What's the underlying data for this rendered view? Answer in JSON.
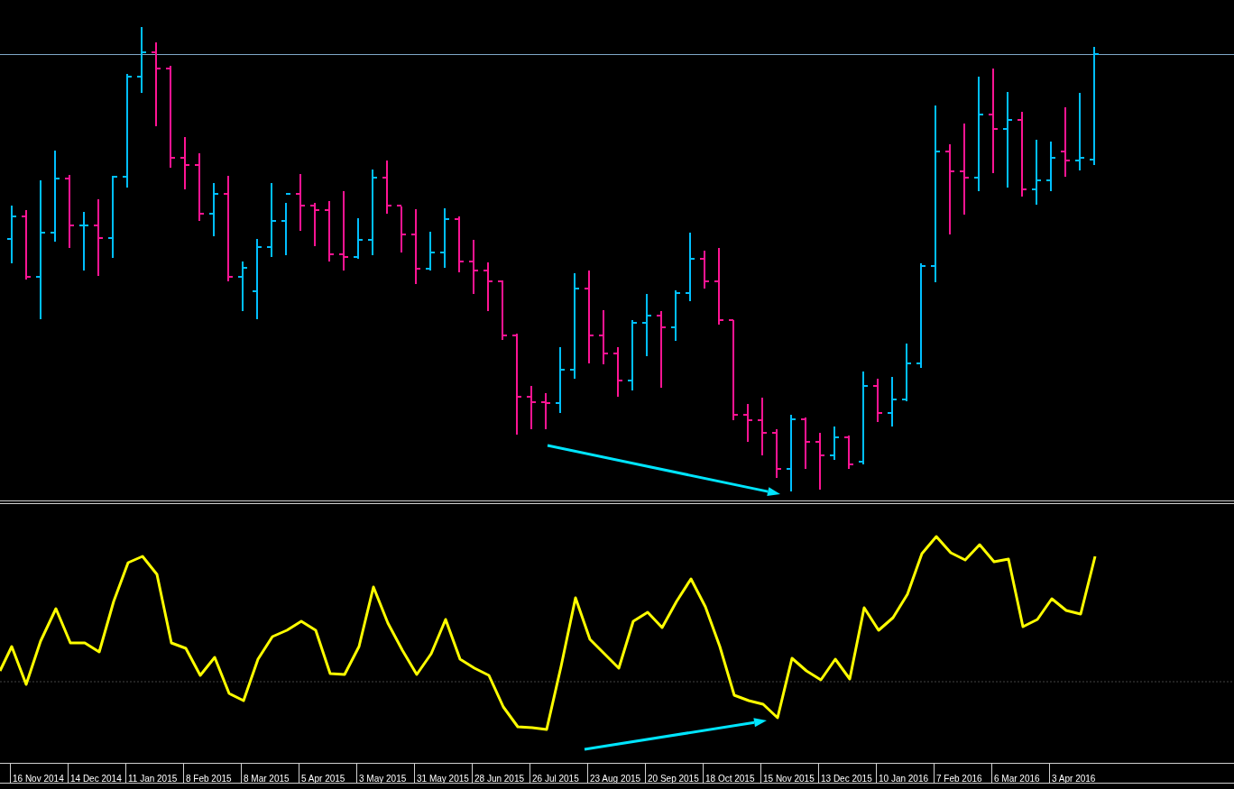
{
  "time_axis": {
    "labels": [
      "16 Nov 2014",
      "14 Dec 2014",
      "11 Jan 2015",
      "8 Feb 2015",
      "8 Mar 2015",
      "5 Apr 2015",
      "3 May 2015",
      "31 May 2015",
      "28 Jun 2015",
      "26 Jul 2015",
      "23 Aug 2015",
      "20 Sep 2015",
      "18 Oct 2015",
      "15 Nov 2015",
      "13 Dec 2015",
      "10 Jan 2016",
      "7 Feb 2016",
      "6 Mar 2016",
      "3 Apr 2016"
    ]
  }
}
